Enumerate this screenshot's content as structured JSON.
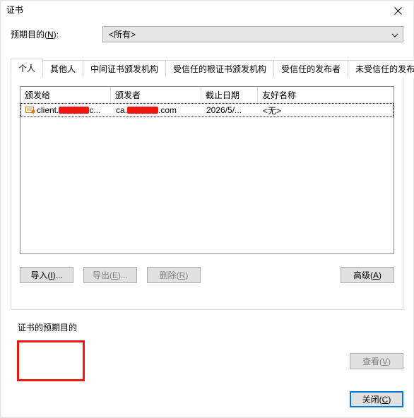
{
  "dialog": {
    "title": "证书"
  },
  "purpose": {
    "label_before": "预期目的(",
    "label_key": "N",
    "label_after": "):",
    "value": "<所有>"
  },
  "tabs": [
    {
      "label": "个人",
      "active": true
    },
    {
      "label": "其他人"
    },
    {
      "label": "中间证书颁发机构"
    },
    {
      "label": "受信任的根证书颁发机构"
    },
    {
      "label": "受信任的发布者"
    },
    {
      "label": "未受信任的发布者"
    }
  ],
  "listview": {
    "columns": [
      "颁发给",
      "颁发者",
      "截止日期",
      "友好名称"
    ],
    "rows": [
      {
        "issued_to_prefix": "client.",
        "issued_to_suffix": "c...",
        "issuer_prefix": "ca.",
        "issuer_suffix": ".com",
        "expiry": "2026/5/...",
        "friendly": "<无>"
      }
    ]
  },
  "buttons": {
    "import_before": "导入(",
    "import_key": "I",
    "import_after": ")...",
    "export_before": "导出(",
    "export_key": "E",
    "export_after": ")...",
    "remove_before": "删除(",
    "remove_key": "R",
    "remove_after": ")",
    "advanced_before": "高级(",
    "advanced_key": "A",
    "advanced_after": ")",
    "view_before": "查看(",
    "view_key": "V",
    "view_after": ")",
    "close_before": "关闭(",
    "close_key": "C",
    "close_after": ")"
  },
  "section": {
    "cert_purposes": "证书的预期目的"
  }
}
